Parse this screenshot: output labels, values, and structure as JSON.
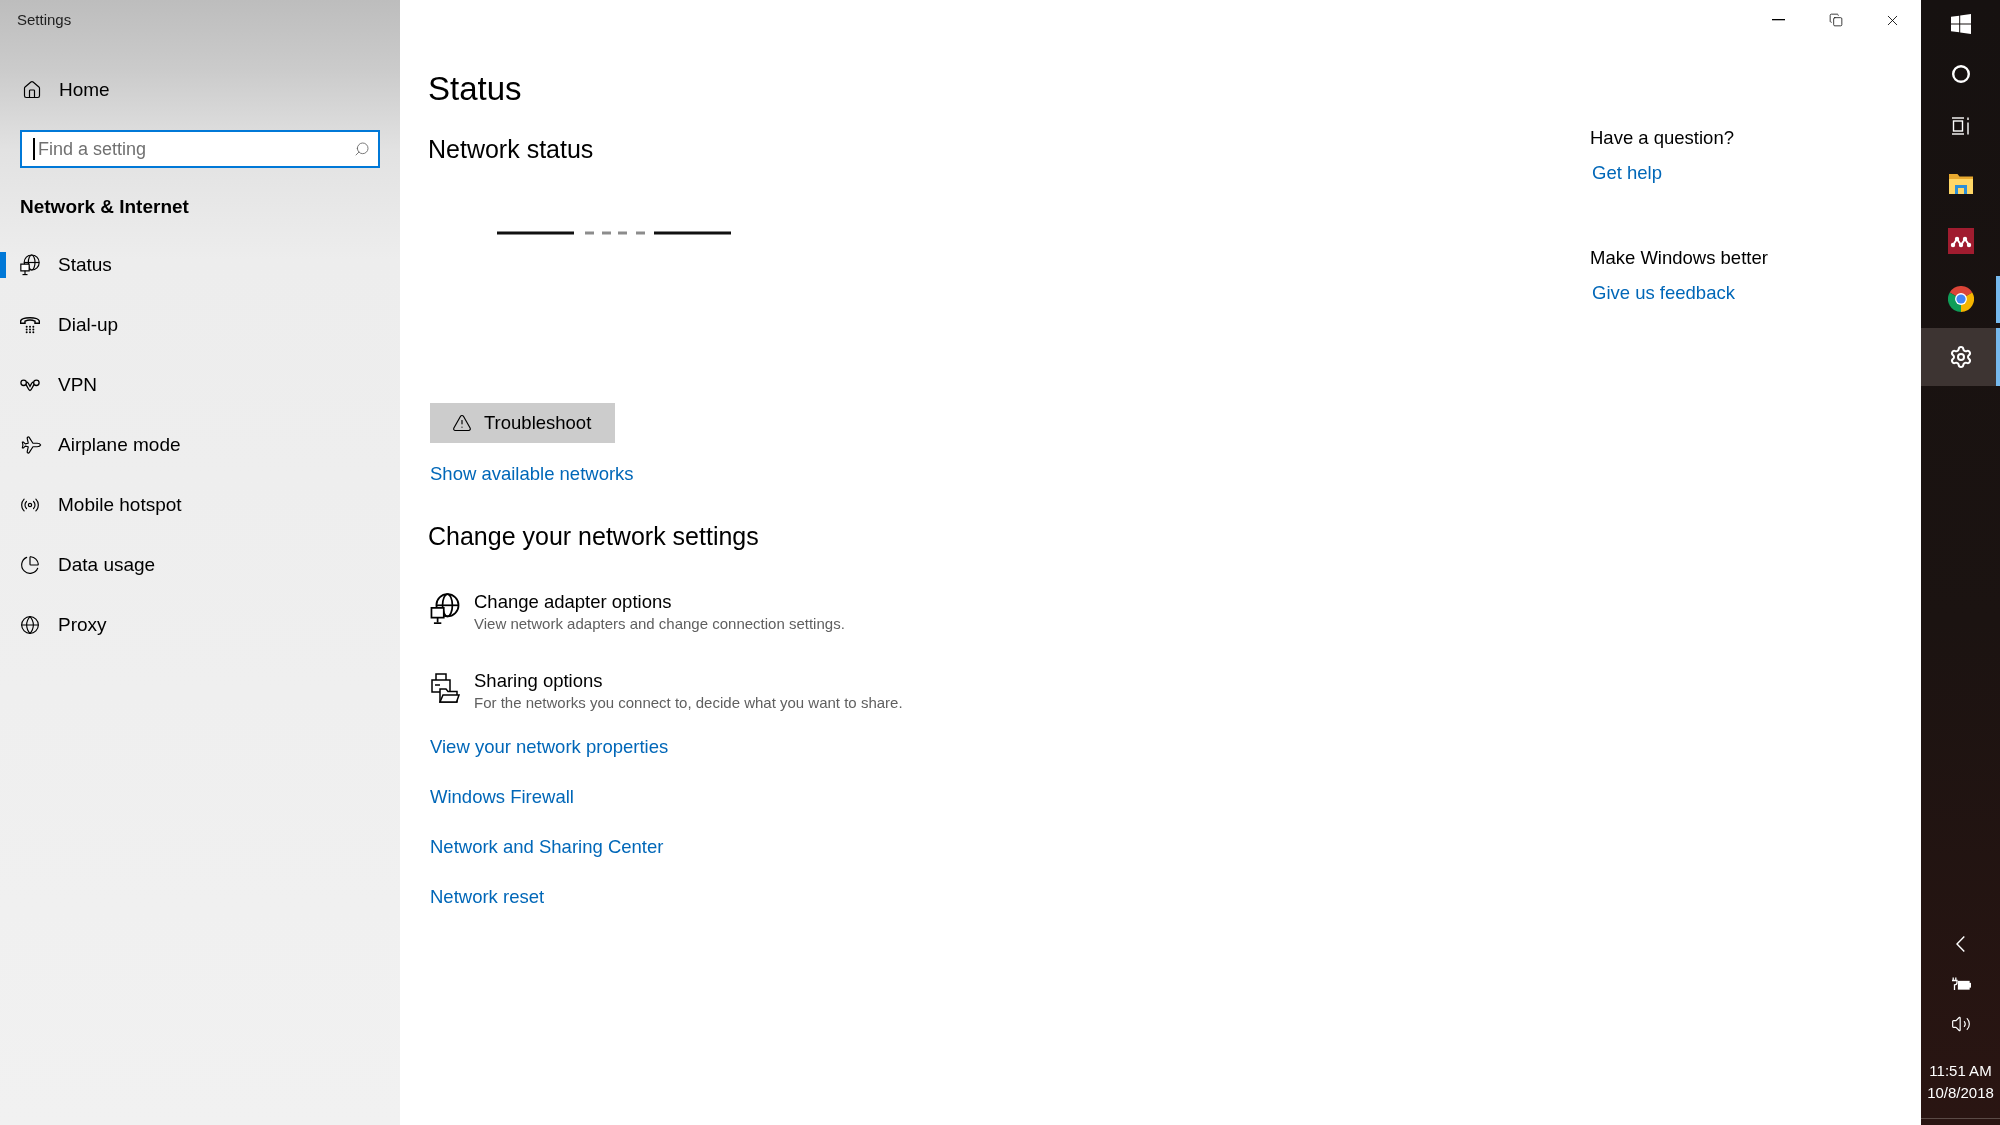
{
  "window": {
    "title": "Settings"
  },
  "sidebar": {
    "home": {
      "label": "Home"
    },
    "search": {
      "placeholder": "Find a setting",
      "focused": true
    },
    "section_title": "Network & Internet",
    "items": [
      {
        "label": "Status",
        "selected": true
      },
      {
        "label": "Dial-up",
        "selected": false
      },
      {
        "label": "VPN",
        "selected": false
      },
      {
        "label": "Airplane mode",
        "selected": false
      },
      {
        "label": "Mobile hotspot",
        "selected": false
      },
      {
        "label": "Data usage",
        "selected": false
      },
      {
        "label": "Proxy",
        "selected": false
      }
    ]
  },
  "page": {
    "title": "Status",
    "network_status": {
      "heading": "Network status",
      "troubleshoot_button": "Troubleshoot",
      "link": "Show available networks"
    },
    "change_settings": {
      "heading": "Change your network settings",
      "options": [
        {
          "title": "Change adapter options",
          "description": "View network adapters and change connection settings."
        },
        {
          "title": "Sharing options",
          "description": "For the networks you connect to, decide what you want to share."
        }
      ],
      "links": [
        "View your network properties",
        "Windows Firewall",
        "Network and Sharing Center",
        "Network reset"
      ]
    }
  },
  "help_panel": [
    {
      "heading": "Have a question?",
      "link": "Get help"
    },
    {
      "heading": "Make Windows better",
      "link": "Give us feedback"
    }
  ],
  "taskbar": {
    "apps": [
      {
        "running": false,
        "selected": false
      },
      {
        "running": false,
        "selected": false
      },
      {
        "running": true,
        "selected": false
      },
      {
        "running": true,
        "selected": true
      }
    ],
    "clock": {
      "time": "11:51 AM",
      "date": "10/8/2018"
    }
  }
}
